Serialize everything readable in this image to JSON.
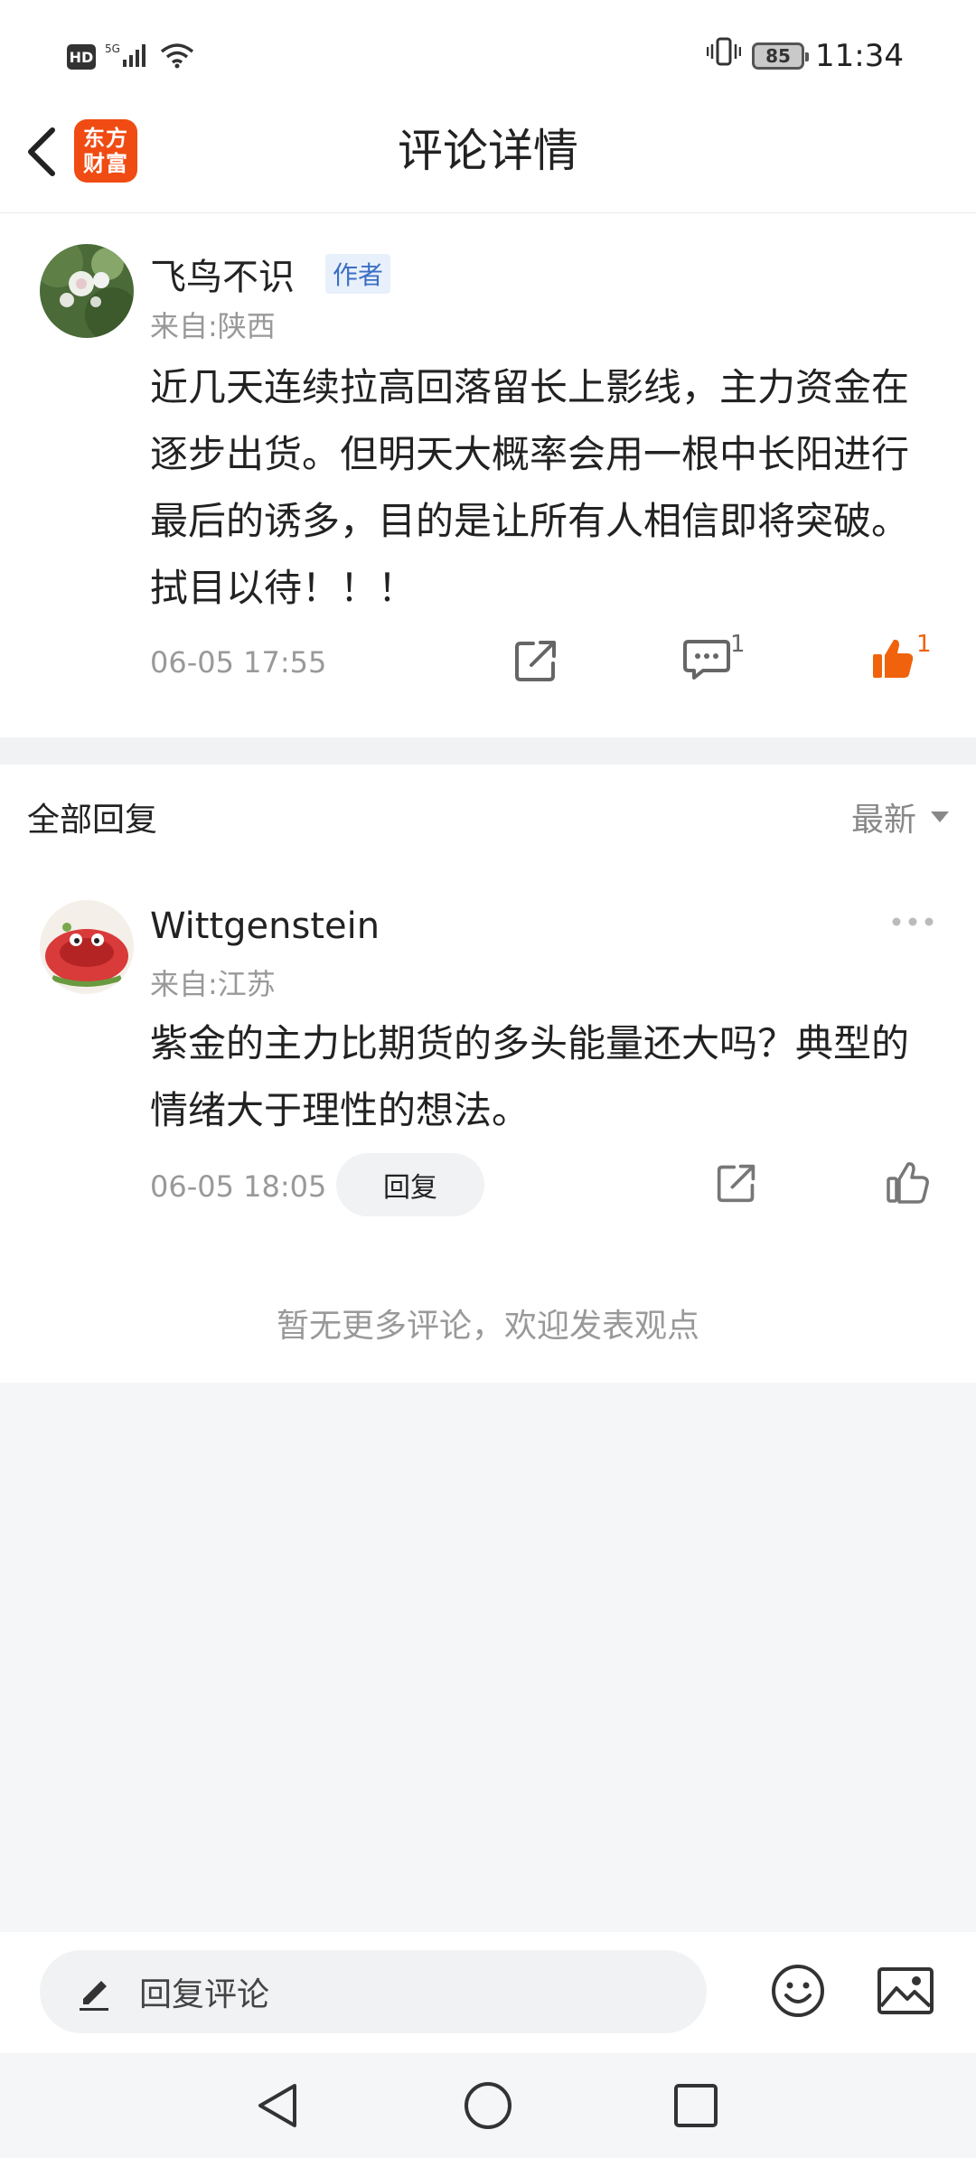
{
  "status_bar": {
    "hd": "HD",
    "network": "5G",
    "battery": "85",
    "time": "11:34"
  },
  "header": {
    "title": "评论详情",
    "logo_line1": "东方",
    "logo_line2": "财富"
  },
  "main_comment": {
    "username": "飞鸟不识",
    "author_badge": "作者",
    "location": "来自:陕西",
    "content": "近几天连续拉高回落留长上影线，主力资金在逐步出货。但明天大概率会用一根中长阳进行最后的诱多，目的是让所有人相信即将突破。拭目以待！！！",
    "time": "06-05 17:55",
    "comment_count": "1",
    "like_count": "1",
    "accent_color": "#f0620c"
  },
  "replies": {
    "title": "全部回复",
    "sort_label": "最新",
    "items": [
      {
        "username": "Wittgenstein",
        "location": "来自:江苏",
        "content": "紫金的主力比期货的多头能量还大吗？典型的情绪大于理性的想法。",
        "time": "06-05 18:05",
        "reply_label": "回复"
      }
    ],
    "no_more_text": "暂无更多评论，欢迎发表观点"
  },
  "bottom_bar": {
    "input_placeholder": "回复评论"
  }
}
